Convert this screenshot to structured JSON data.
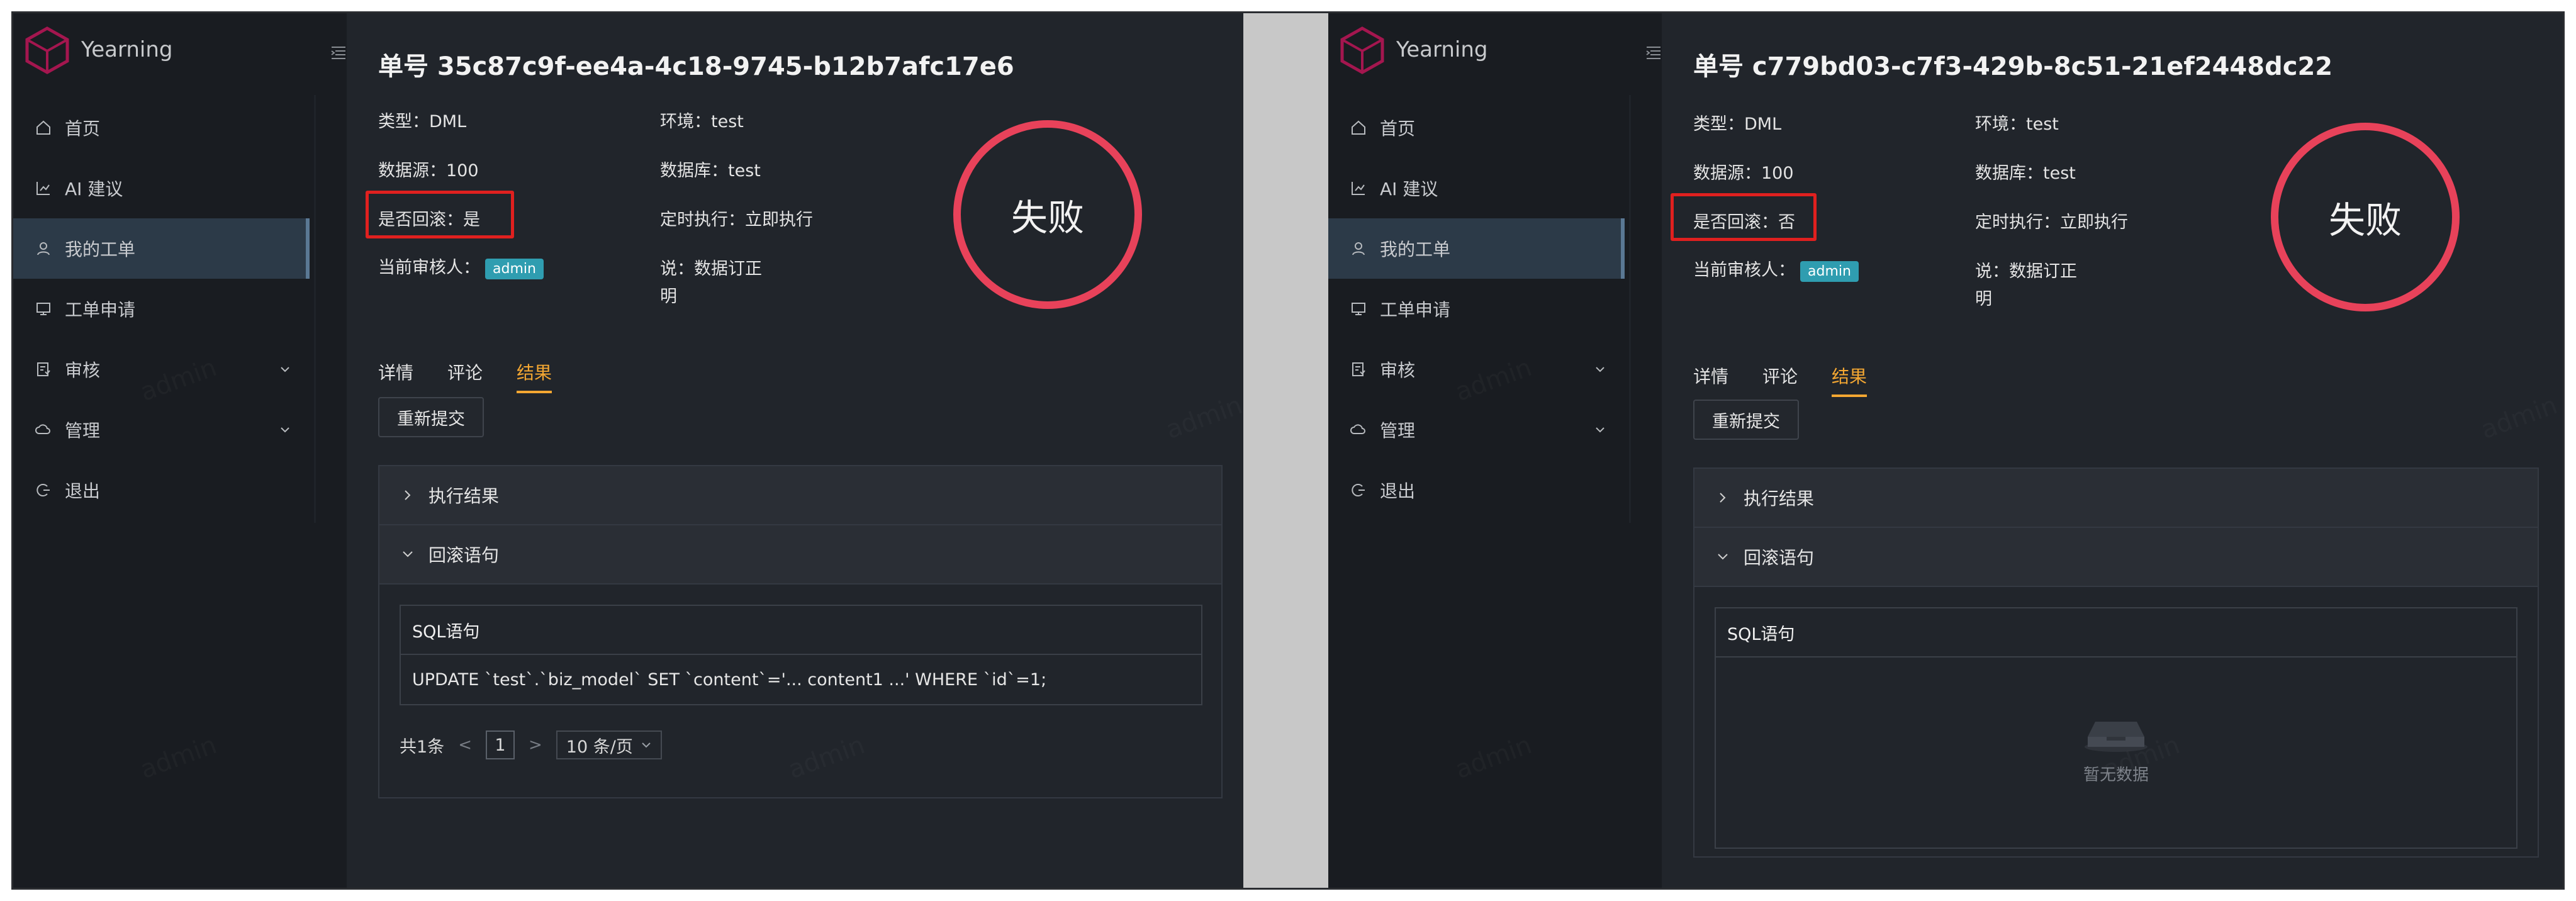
{
  "app": {
    "name": "Yearning"
  },
  "nav": {
    "items": [
      {
        "label": "首页",
        "icon": "home-icon"
      },
      {
        "label": "AI 建议",
        "icon": "chart-icon"
      },
      {
        "label": "我的工单",
        "icon": "user-icon"
      },
      {
        "label": "工单申请",
        "icon": "form-icon"
      },
      {
        "label": "审核",
        "icon": "audit-icon"
      },
      {
        "label": "管理",
        "icon": "cloud-icon"
      },
      {
        "label": "退出",
        "icon": "logout-icon"
      }
    ],
    "active": "我的工单"
  },
  "watermark": "admin",
  "panels": [
    {
      "order_title": "单号 35c87c9f-ee4a-4c18-9745-b12b7afc17e6",
      "type": "类型：DML",
      "env": "环境：test",
      "source": "数据源：100",
      "database": "数据库：test",
      "rollback": "是否回滚：是",
      "schedule": "定时执行：立即执行",
      "reviewer_label": "当前审核人：",
      "reviewer": "admin",
      "desc_line1": "说：数据订正",
      "desc_line2": "明",
      "status_stamp": "失败",
      "tabs": [
        "详情",
        "评论",
        "结果"
      ],
      "resubmit_label": "重新提交",
      "collapse": [
        "执行结果",
        "回滚语句"
      ],
      "table_header": "SQL语句",
      "table_rows": [
        "UPDATE `test`.`biz_model` SET `content`='... content1 ...' WHERE `id`=1;"
      ],
      "pager": {
        "total": "共1条",
        "prev": "<",
        "page": "1",
        "next": ">",
        "size": "10 条/页"
      }
    },
    {
      "order_title": "单号 c779bd03-c7f3-429b-8c51-21ef2448dc22",
      "type": "类型：DML",
      "env": "环境：test",
      "source": "数据源：100",
      "database": "数据库：test",
      "rollback": "是否回滚：否",
      "schedule": "定时执行：立即执行",
      "reviewer_label": "当前审核人：",
      "reviewer": "admin",
      "desc_line1": "说：数据订正",
      "desc_line2": "明",
      "status_stamp": "失败",
      "tabs": [
        "详情",
        "评论",
        "结果"
      ],
      "resubmit_label": "重新提交",
      "collapse": [
        "执行结果",
        "回滚语句"
      ],
      "table_header": "SQL语句",
      "empty_text": "暂无数据"
    }
  ],
  "colors": {
    "accent": "#f4a732",
    "stamp": "#e8425a",
    "badge": "#2f9db0",
    "highlight": "#e0201f"
  }
}
